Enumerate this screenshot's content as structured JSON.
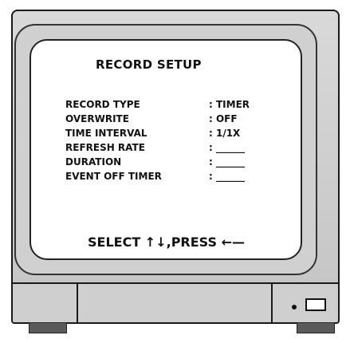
{
  "screen": {
    "title": "RECORD SETUP",
    "items": [
      {
        "label": "RECORD TYPE",
        "value": ": TIMER"
      },
      {
        "label": "OVERWRITE",
        "value": ": OFF"
      },
      {
        "label": "TIME INTERVAL",
        "value": ": 1/1X"
      },
      {
        "label": "REFRESH RATE",
        "value": ": ______"
      },
      {
        "label": "DURATION",
        "value": ": ______"
      },
      {
        "label": "EVENT OFF TIMER",
        "value": ": ______"
      }
    ],
    "footer": "SELECT ↑↓,PRESS ←—"
  },
  "controls": {
    "led_icon": "status-led-icon",
    "power_icon": "power-button-icon"
  }
}
